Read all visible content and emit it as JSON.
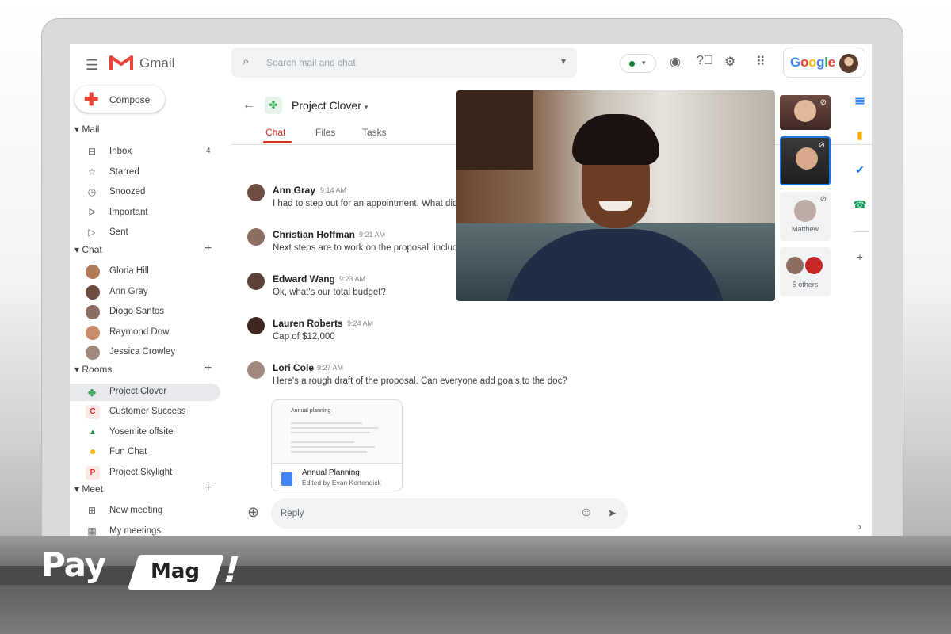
{
  "app": {
    "name": "Gmail",
    "search_placeholder": "Search mail and chat",
    "google_wordmark": "Google"
  },
  "compose_label": "Compose",
  "sections": {
    "mail": "Mail",
    "chat": "Chat",
    "rooms": "Rooms",
    "meet": "Meet"
  },
  "mail_items": [
    {
      "label": "Inbox",
      "count": "4",
      "icon": "inbox-icon"
    },
    {
      "label": "Starred",
      "icon": "star-icon"
    },
    {
      "label": "Snoozed",
      "icon": "clock-icon"
    },
    {
      "label": "Important",
      "icon": "label-important-icon"
    },
    {
      "label": "Sent",
      "icon": "send-icon"
    }
  ],
  "chat_items": [
    "Gloria Hill",
    "Ann Gray",
    "Diogo Santos",
    "Raymond Dow",
    "Jessica Crowley"
  ],
  "room_items": [
    {
      "label": "Project Clover",
      "badge": "✤",
      "color": "#34a853"
    },
    {
      "label": "Customer Success",
      "badge": "C",
      "color": "#d93025"
    },
    {
      "label": "Yosemite offsite",
      "badge": "▲",
      "color": "#1e8e3e"
    },
    {
      "label": "Fun Chat",
      "badge": "☻",
      "color": "#f9ab00"
    },
    {
      "label": "Project Skylight",
      "badge": "P",
      "color": "#d93025"
    }
  ],
  "meet_items": [
    "New meeting",
    "My meetings"
  ],
  "room": {
    "name": "Project Clover",
    "tabs": [
      "Chat",
      "Files",
      "Tasks"
    ],
    "active_tab": "Chat"
  },
  "messages": [
    {
      "name": "Ann Gray",
      "time": "9:14 AM",
      "text": "I had to step out for an appointment. What did"
    },
    {
      "name": "Christian Hoffman",
      "time": "9:21 AM",
      "text": "Next steps are to work on the proposal, includ"
    },
    {
      "name": "Edward Wang",
      "time": "9:23 AM",
      "text": "Ok, what's our total budget?"
    },
    {
      "name": "Lauren Roberts",
      "time": "9:24 AM",
      "text": "Cap of $12,000"
    },
    {
      "name": "Lori Cole",
      "time": "9:27 AM",
      "text": "Here's a rough draft of the proposal. Can everyone add goals to the doc?"
    }
  ],
  "attachment": {
    "preview_title": "Annual planning",
    "title": "Annual Planning",
    "subtitle": "Edited by Evan Kortendick"
  },
  "reply_placeholder": "Reply",
  "call": {
    "participant_label": "Matthew",
    "others_label": "5 others"
  },
  "brand": {
    "pay": "Pay",
    "mag": "Mag",
    "mark": "!"
  },
  "colors": {
    "accent": "#d93025",
    "online": "#188038",
    "active_room_bg": "#e8eaed"
  }
}
